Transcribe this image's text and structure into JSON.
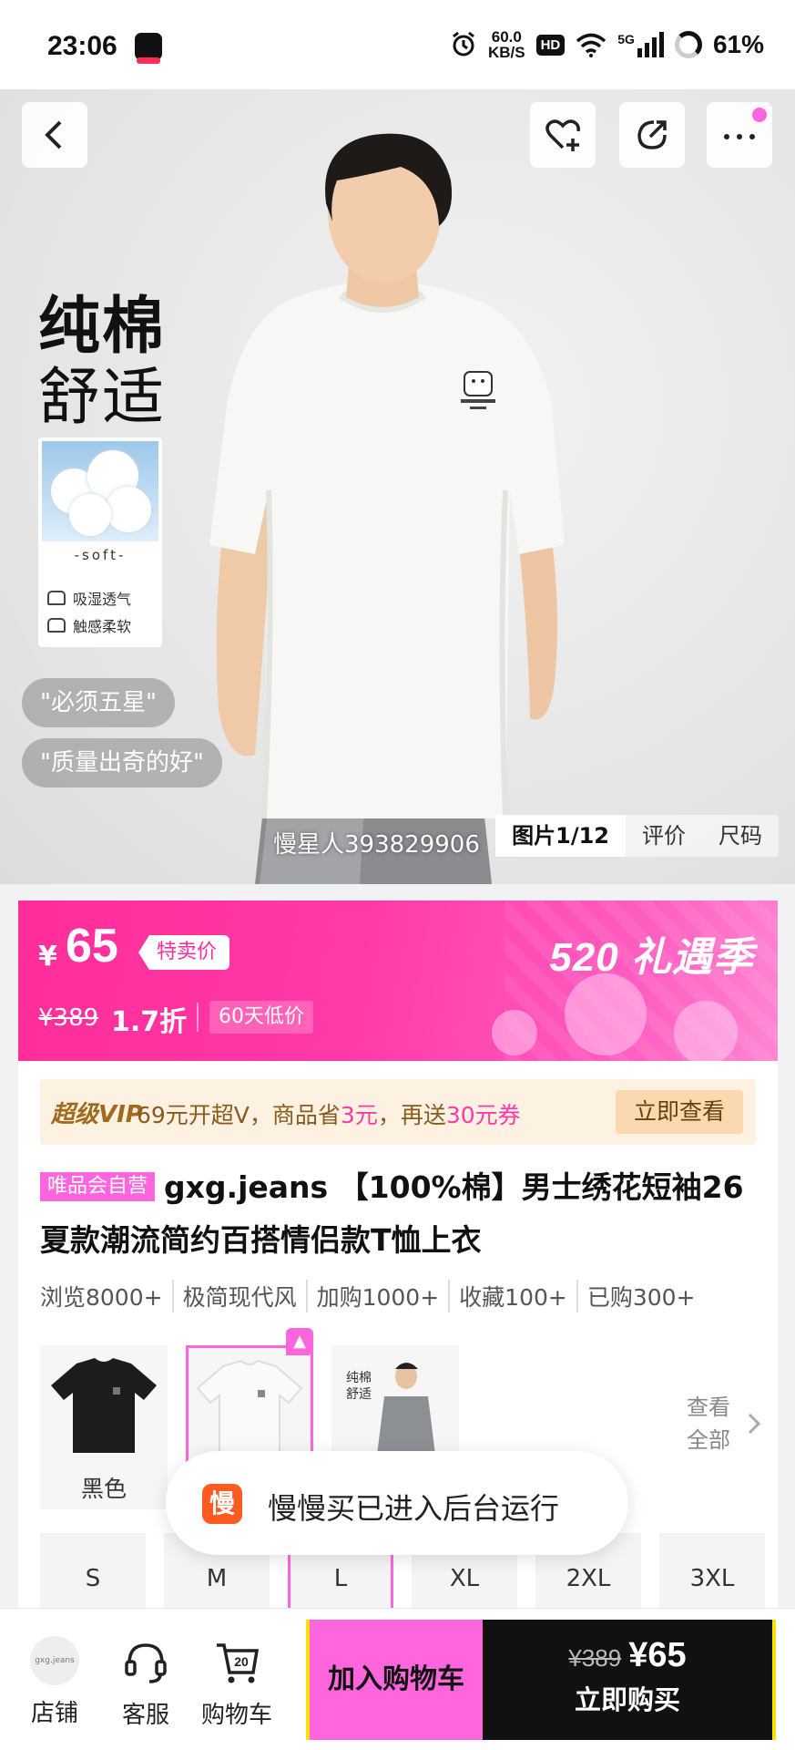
{
  "status_bar": {
    "time": "23:06",
    "net_speed_value": "60.0",
    "net_speed_unit": "KB/S",
    "hd": "HD",
    "signal": "5G",
    "battery": "61%"
  },
  "hero": {
    "headline_1": "纯棉",
    "headline_2": "舒适",
    "soft_label": "-soft-",
    "features": [
      "吸湿透气",
      "触感柔软"
    ],
    "reviews": [
      "\"必须五星\"",
      "\"质量出奇的好\""
    ],
    "watermark": "慢星人393829906",
    "tabs": [
      "图片1/12",
      "评价",
      "尺码"
    ],
    "icons": [
      "back-icon",
      "favorite-add-icon",
      "share-icon",
      "more-icon"
    ]
  },
  "price": {
    "currency": "¥",
    "amount": "65",
    "tag": "特卖价",
    "original": "¥389",
    "discount": "1.7折",
    "low_price_note": "60天低价",
    "event": "520 礼遇季",
    "colors": {
      "accent": "#ff2d9a",
      "pink": "#ff66dd"
    }
  },
  "vip": {
    "label": "超级VIP",
    "text_1": "69元开超V，商品省",
    "hl_1": "3元",
    "text_2": "，再送",
    "hl_2": "30元券",
    "button": "立即查看"
  },
  "product": {
    "self_tag": "唯品会自营",
    "title": "gxg.jeans 【100%棉】男士绣花短袖26夏款潮流简约百搭情侣款T恤上衣",
    "stats": [
      "浏览8000+",
      "极简现代风",
      "加购1000+",
      "收藏100+",
      "已购300+"
    ]
  },
  "variants": {
    "items": [
      {
        "label": "黑色"
      },
      {
        "label": ""
      },
      {
        "label": ""
      }
    ],
    "see_all_1": "查看",
    "see_all_2": "全部"
  },
  "sizes": [
    "S",
    "M",
    "L",
    "XL",
    "2XL",
    "3XL"
  ],
  "toast": {
    "icon_char": "慢",
    "text": "慢慢买已进入后台运行"
  },
  "bottom": {
    "store": "店铺",
    "store_logo": "gxg.jeans",
    "service": "客服",
    "cart": "购物车",
    "cart_count": "20",
    "add_to_cart": "加入购物车",
    "buy_original": "¥389",
    "buy_price": "¥65",
    "buy_now": "立即购买"
  }
}
